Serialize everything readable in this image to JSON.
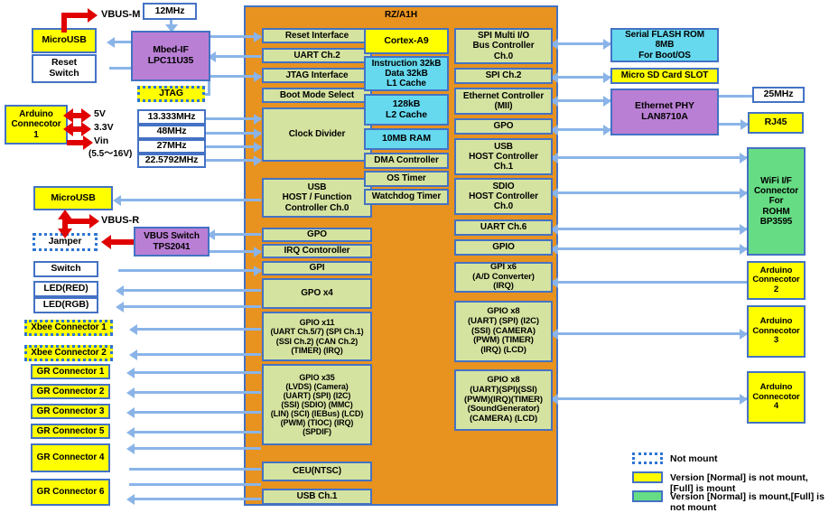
{
  "diagram": {
    "title": "RZ/A1H",
    "soc_label": "RZ/A1H"
  },
  "left_column": {
    "microusb_top": "MicroUSB",
    "reset_switch": "Reset\nSwitch",
    "arduino_connector_1": "Arduino\nConnecotor\n1",
    "microusb_mid": "MicroUSB",
    "jamper": "Jamper",
    "switch": "Switch",
    "led_red": "LED(RED)",
    "led_rgb": "LED(RGB)",
    "xbee1": "Xbee Connector 1",
    "xbee2": "Xbee Connector 2",
    "gr1": "GR Connector 1",
    "gr2": "GR Connector 2",
    "gr3": "GR Connector 3",
    "gr5": "GR Connector 5",
    "gr4": "GR Connector 4",
    "gr6": "GR Connector 6"
  },
  "power_labels": {
    "vbus_m": "VBUS-M",
    "vbus_r": "VBUS-R",
    "v5": "5V",
    "v33": "3.3V",
    "vin": "Vin",
    "vin_range": "(5.5～16V)"
  },
  "mid_left": {
    "clock_12mhz": "12MHz",
    "mbed_if": "Mbed-IF\nLPC11U35",
    "jtag": "JTAG",
    "clk_13333": "13.333MHz",
    "clk_48": "48MHz",
    "clk_27": "27MHz",
    "clk_22579": "22.5792MHz",
    "vbus_switch": "VBUS Switch\nTPS2041"
  },
  "soc_left_blocks": [
    {
      "label": "Reset Interface"
    },
    {
      "label": "UART Ch.2"
    },
    {
      "label": "JTAG Interface"
    },
    {
      "label": "Boot Mode Select"
    },
    {
      "label": "Clock Divider"
    },
    {
      "label": "USB\nHOST / Function\nController Ch.0"
    },
    {
      "label": "GPO"
    },
    {
      "label": "IRQ Contoroller"
    },
    {
      "label": "GPI"
    },
    {
      "label": "GPO x4"
    },
    {
      "label": "GPIO x11\n(UART Ch.5/7) (SPI Ch.1)\n(SSI Ch.2) (CAN Ch.2)\n(TIMER) (IRQ)"
    },
    {
      "label": "GPIO x35\n(LVDS) (Camera)\n(UART) (SPI) (I2C)\n(SSI) (SDIO) (MMC)\n(LIN) (SCI) (IEBus) (LCD)\n(PWM) (TIOC) (IRQ)\n(SPDIF)"
    },
    {
      "label": "CEU(NTSC)"
    },
    {
      "label": "USB Ch.1"
    }
  ],
  "soc_cpu_blocks": [
    {
      "label": "Cortex-A9",
      "color": "yellow"
    },
    {
      "label": "Instruction 32kB\nData 32kB\nL1 Cache",
      "color": "cyan"
    },
    {
      "label": "128kB\nL2 Cache",
      "color": "cyan"
    },
    {
      "label": "10MB RAM",
      "color": "cyan"
    },
    {
      "label": "DMA Controller",
      "color": "olive"
    },
    {
      "label": "OS Timer",
      "color": "olive"
    },
    {
      "label": "Watchdog Timer",
      "color": "olive"
    }
  ],
  "soc_right_blocks": [
    {
      "label": "SPI Multi I/O\nBus Controller\nCh.0"
    },
    {
      "label": "SPI Ch.2"
    },
    {
      "label": "Ethernet Controller\n(MII)"
    },
    {
      "label": "GPO"
    },
    {
      "label": "USB\nHOST Controller\nCh.1"
    },
    {
      "label": "SDIO\nHOST Controller\nCh.0"
    },
    {
      "label": "UART Ch.6"
    },
    {
      "label": "GPIO"
    },
    {
      "label": "GPI x6\n(A/D Converter)\n(IRQ)"
    },
    {
      "label": "GPIO x8\n(UART) (SPI) (I2C)\n(SSI) (CAMERA)\n(PWM) (TIMER)\n(IRQ) (LCD)"
    },
    {
      "label": "GPIO x8\n(UART)(SPI)(SSI)\n(PWM)(IRQ)(TIMER)\n(SoundGenerator)\n(CAMERA) (LCD)"
    }
  ],
  "right_column": {
    "serial_flash": "Serial FLASH ROM\n8MB\nFor Boot/OS",
    "micro_sd": "Micro SD Card SLOT",
    "ethernet_phy": "Ethernet PHY\nLAN8710A",
    "clock_25mhz": "25MHz",
    "rj45": "RJ45",
    "wifi": "WiFi I/F\nConnector\nFor\nROHM\nBP3595",
    "arduino2": "Arduino\nConnecotor\n2",
    "arduino3": "Arduino\nConnecotor\n3",
    "arduino4": "Arduino\nConnecotor\n4"
  },
  "legend": [
    {
      "style": "dotted",
      "text": "Not mount"
    },
    {
      "style": "yellow",
      "text": "Version [Normal] is not mount,[Full] is mount"
    },
    {
      "style": "green",
      "text": "Version [Normal] is mount,[Full] is not mount"
    }
  ],
  "colors": {
    "soc_fill": "#e8921f",
    "border": "#4472c4",
    "arrow": "#8ab4e8",
    "power_arrow": "#e00000",
    "yellow": "#ffff00",
    "purple": "#b97fd4",
    "cyan": "#66d9ef",
    "green": "#66dd84",
    "olive": "#d5e3a0"
  }
}
